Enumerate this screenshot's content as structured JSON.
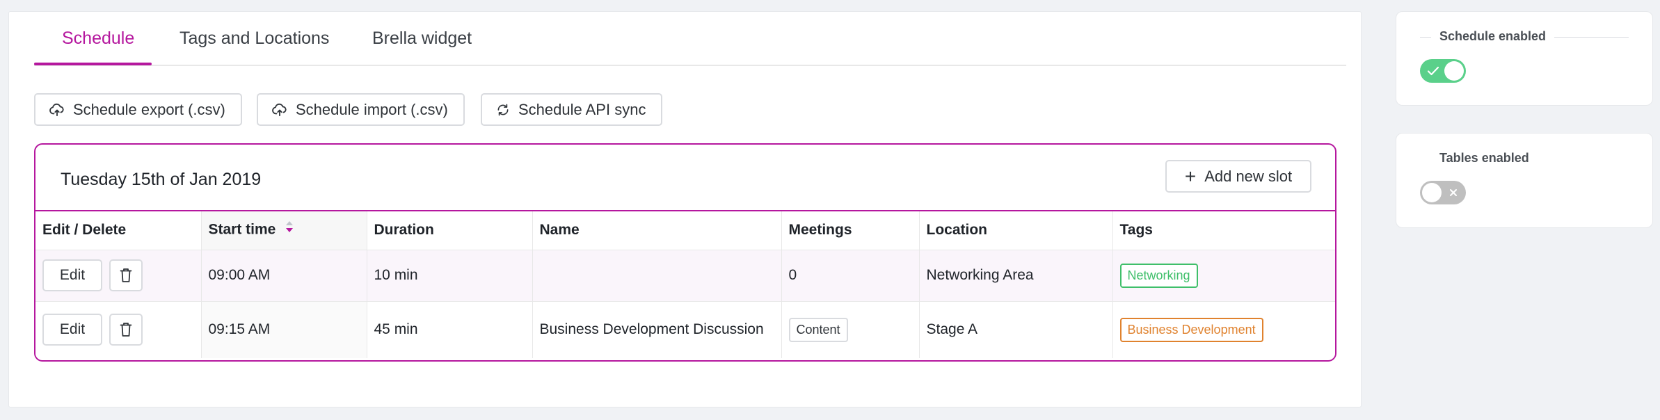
{
  "tabs": [
    {
      "label": "Schedule",
      "active": true
    },
    {
      "label": "Tags and Locations",
      "active": false
    },
    {
      "label": "Brella widget",
      "active": false
    }
  ],
  "toolbar": {
    "export_label": "Schedule export (.csv)",
    "import_label": "Schedule import (.csv)",
    "sync_label": "Schedule API sync"
  },
  "day": {
    "title": "Tuesday 15th of Jan 2019",
    "add_slot_label": "Add new slot"
  },
  "table": {
    "headers": [
      "Edit / Delete",
      "Start time",
      "Duration",
      "Name",
      "Meetings",
      "Location",
      "Tags"
    ],
    "rows": [
      {
        "edit_label": "Edit",
        "start_time": "09:00 AM",
        "duration": "10 min",
        "name": "",
        "meetings": "0",
        "location": "Networking Area",
        "tag": "Networking",
        "tag_color": "#3fbf6a"
      },
      {
        "edit_label": "Edit",
        "start_time": "09:15 AM",
        "duration": "45 min",
        "name": "Business Development Discussion",
        "meetings": "Content",
        "location": "Stage A",
        "tag": "Business Development",
        "tag_color": "#e0822e"
      }
    ]
  },
  "settings": {
    "schedule_enabled": {
      "label": "Schedule enabled",
      "on": true
    },
    "tables_enabled": {
      "label": "Tables enabled",
      "on": false
    }
  },
  "colors": {
    "accent": "#b5179e",
    "toggle_on": "#5ad08a",
    "toggle_off": "#bfbfbf"
  },
  "icons": {
    "export": "cloud-upload-icon",
    "import": "cloud-upload-icon",
    "sync": "sync-icon",
    "add": "plus-icon",
    "delete": "trash-icon",
    "sort": "sort-icon",
    "check": "check-icon",
    "close": "close-icon"
  }
}
